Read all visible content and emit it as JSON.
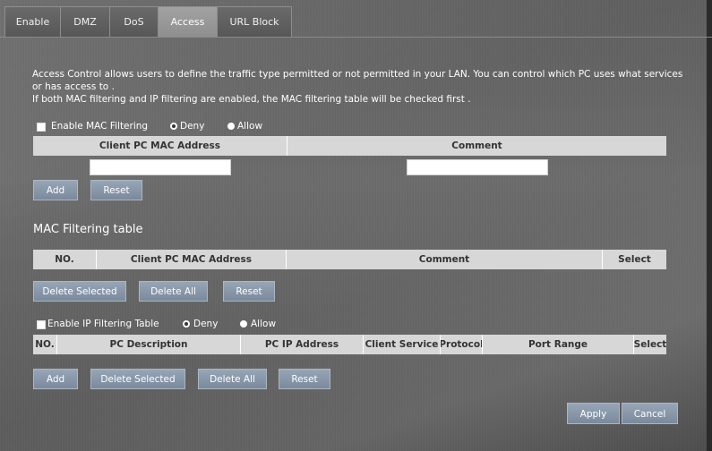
{
  "tabs": [
    "Enable",
    "DMZ",
    "DoS",
    "Access",
    "URL Block"
  ],
  "active_tab": "Access",
  "description": {
    "line1": "Access Control allows users to define the traffic type permitted or not permitted in your LAN. You can control which PC uses what services",
    "line2": "or has access to .",
    "line3": "If both MAC filtering and IP filtering are enabled, the MAC filtering table will be checked first ."
  },
  "mac_filter": {
    "enable_label": "Enable MAC Filtering",
    "enabled": false,
    "deny_label": "Deny",
    "allow_label": "Allow",
    "selected_mode": "Deny",
    "columns": [
      "Client PC MAC Address",
      "Comment"
    ],
    "mac_value": "",
    "comment_value": "",
    "add_label": "Add",
    "reset_label": "Reset"
  },
  "mac_table": {
    "title": "MAC Filtering table",
    "columns": [
      "NO.",
      "Client PC MAC Address",
      "Comment",
      "Select"
    ],
    "rows": [],
    "delete_selected_label": "Delete Selected",
    "delete_all_label": "Delete All",
    "reset_label": "Reset"
  },
  "ip_filter": {
    "enable_label": "Enable IP Filtering Table",
    "enabled": false,
    "deny_label": "Deny",
    "allow_label": "Allow",
    "selected_mode": "Deny",
    "columns": [
      "NO.",
      "PC Description",
      "PC IP Address",
      "Client Service",
      "Protocol",
      "Port Range",
      "Select"
    ],
    "rows": [],
    "add_label": "Add",
    "delete_selected_label": "Delete Selected",
    "delete_all_label": "Delete All",
    "reset_label": "Reset"
  },
  "footer": {
    "apply_label": "Apply",
    "cancel_label": "Cancel"
  },
  "colors": {
    "header_bg": "#d7d7d7",
    "button_bg": "#8a99aa",
    "active_tab": "#9a9a9a"
  }
}
